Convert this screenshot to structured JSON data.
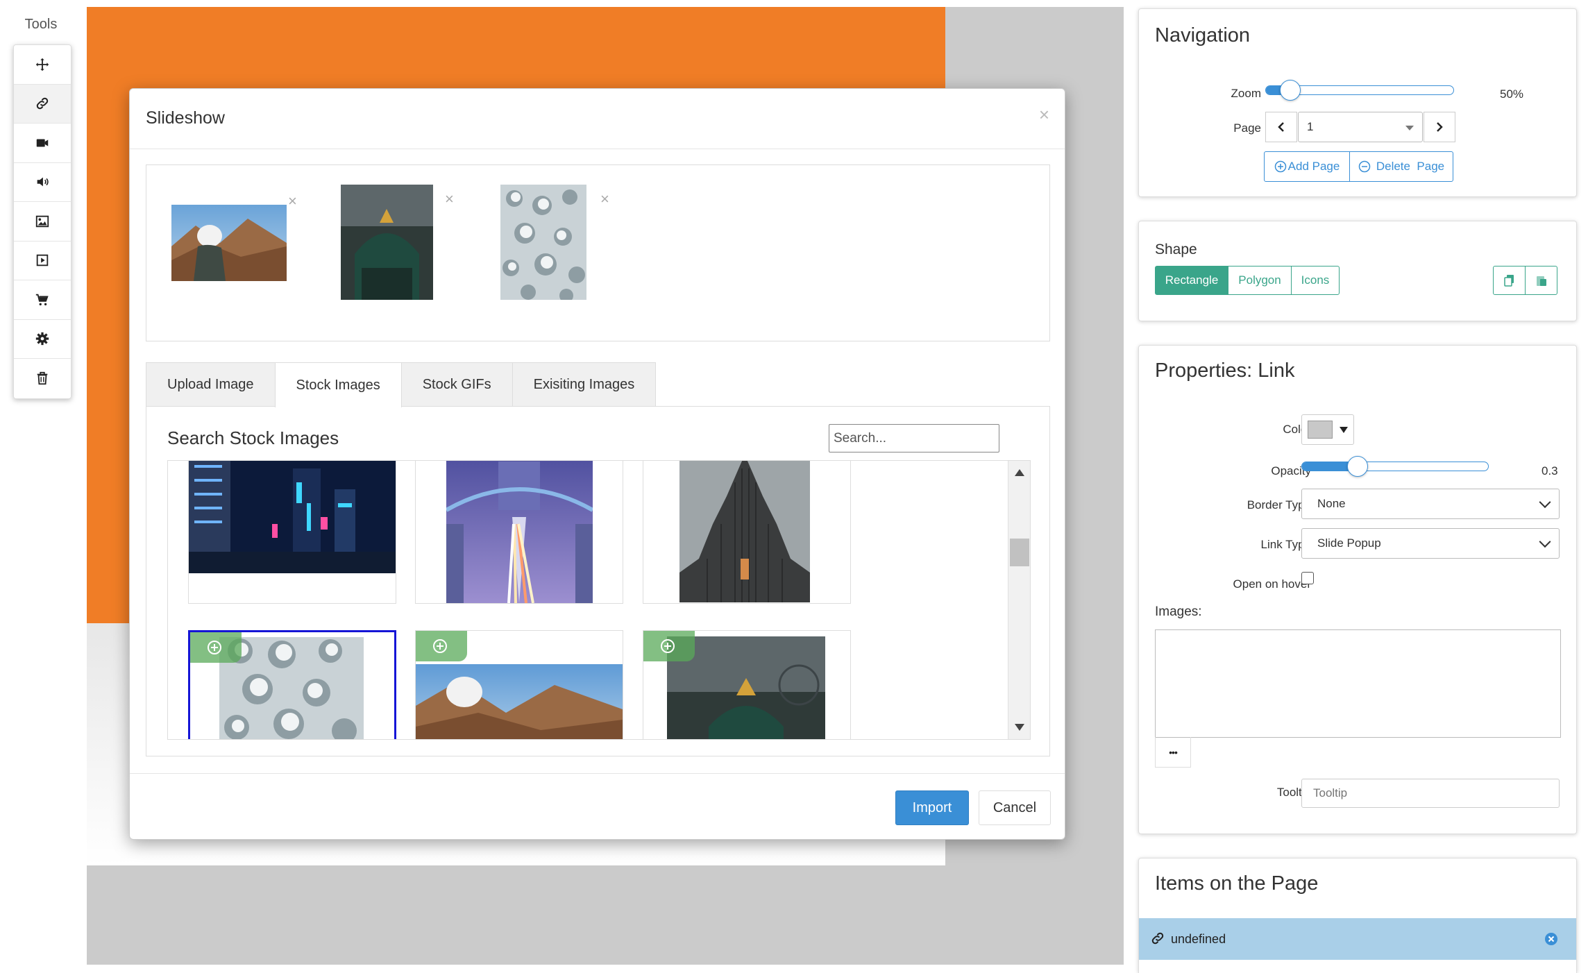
{
  "tools": {
    "label": "Tools",
    "items": [
      {
        "icon": "move-icon"
      },
      {
        "icon": "link-icon",
        "active": true
      },
      {
        "icon": "video-icon"
      },
      {
        "icon": "audio-icon"
      },
      {
        "icon": "image-icon"
      },
      {
        "icon": "slideshow-icon"
      },
      {
        "icon": "cart-icon"
      },
      {
        "icon": "gear-icon"
      },
      {
        "icon": "trash-icon"
      }
    ]
  },
  "modal": {
    "title": "Slideshow",
    "close": "×",
    "thumbnails": [
      {
        "name": "mountain-person"
      },
      {
        "name": "carousel-city"
      },
      {
        "name": "snowy-forest"
      }
    ],
    "remove_glyph": "×",
    "tabs": [
      "Upload Image",
      "Stock Images",
      "Stock GIFs",
      "Exisiting Images"
    ],
    "active_tab": 1,
    "search_title": "Search Stock Images",
    "search_placeholder": "Search...",
    "grid": [
      {
        "name": "neon-city"
      },
      {
        "name": "tower-bridge"
      },
      {
        "name": "church-tower"
      },
      {
        "name": "snowy-forest",
        "selected": true
      },
      {
        "name": "mountain-person"
      },
      {
        "name": "carousel-city"
      }
    ],
    "import_label": "Import",
    "cancel_label": "Cancel"
  },
  "navigation": {
    "title": "Navigation",
    "zoom_label": "Zoom",
    "zoom_value": "50%",
    "zoom_fraction": 0.13,
    "page_label": "Page",
    "page_value": "1",
    "add_page": "Add Page",
    "delete_page": "Delete  Page"
  },
  "shape": {
    "title": "Shape",
    "options": [
      "Rectangle",
      "Polygon",
      "Icons"
    ],
    "active": 0
  },
  "properties": {
    "title": "Properties: Link",
    "color_label": "Color",
    "color_value": "#c8c8c8",
    "opacity_label": "Opacity",
    "opacity_value": "0.3",
    "opacity_fraction": 0.3,
    "border_type_label": "Border Type",
    "border_type_value": "None",
    "link_type_label": "Link Type",
    "link_type_value": "Slide Popup",
    "open_on_hover_label": "Open on hover",
    "images_label": "Images:",
    "more_glyph": "•••",
    "tooltip_label": "Tooltip",
    "tooltip_placeholder": "Tooltip"
  },
  "items_on_page": {
    "title": "Items on the Page",
    "items": [
      {
        "label": "undefined"
      }
    ]
  },
  "colors": {
    "accent": "#3a8fd6",
    "orange": "#f07d26",
    "green": "#3aa58a"
  }
}
